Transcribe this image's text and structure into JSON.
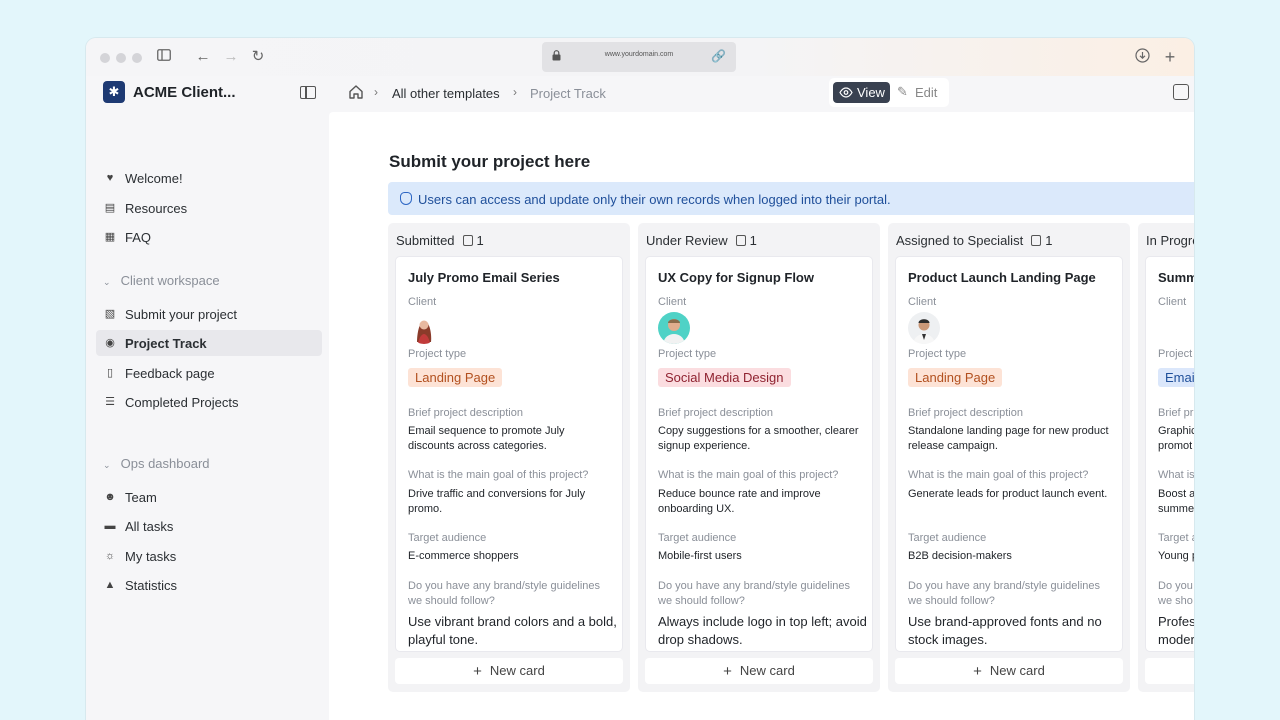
{
  "browser": {
    "url": "www.yourdomain.com"
  },
  "sidebar": {
    "app_title": "ACME Client...",
    "items_top": [
      {
        "label": "Welcome!",
        "icon": "heart-icon"
      },
      {
        "label": "Resources",
        "icon": "document-icon"
      },
      {
        "label": "FAQ",
        "icon": "book-icon"
      }
    ],
    "sections": [
      {
        "title": "Client workspace",
        "items": [
          {
            "label": "Submit your project",
            "icon": "file-icon"
          },
          {
            "label": "Project Track",
            "icon": "eye-icon",
            "active": true
          },
          {
            "label": "Feedback page",
            "icon": "comment-icon"
          },
          {
            "label": "Completed Projects",
            "icon": "database-icon"
          }
        ]
      },
      {
        "title": "Ops dashboard",
        "items": [
          {
            "label": "Team",
            "icon": "users-icon"
          },
          {
            "label": "All tasks",
            "icon": "list-icon"
          },
          {
            "label": "My tasks",
            "icon": "person-scan-icon"
          },
          {
            "label": "Statistics",
            "icon": "chart-icon"
          }
        ]
      }
    ]
  },
  "header": {
    "breadcrumb": [
      "All other templates",
      "Project Track"
    ],
    "view_label": "View",
    "edit_label": "Edit"
  },
  "main": {
    "title": "Submit your project here",
    "notice": "Users can access and update only their own records when logged into their portal.",
    "new_card_label": "New card",
    "field_labels": {
      "client": "Client",
      "project_type": "Project type",
      "brief": "Brief project description",
      "goal": "What is the main goal of this project?",
      "audience": "Target audience",
      "guidelines": "Do you have any brand/style guidelines we should follow?"
    },
    "columns": [
      {
        "title": "Submitted",
        "count": "1",
        "card": {
          "title": "July Promo Email Series",
          "tag": "Landing Page",
          "tag_color": "#fde3d6",
          "tag_text": "#b2501f",
          "brief": "Email sequence to promote July discounts across categories.",
          "goal": "Drive traffic and conversions for July promo.",
          "audience": "E-commerce shoppers",
          "guidelines": "Use vibrant brand colors and a bold, playful tone."
        }
      },
      {
        "title": "Under Review",
        "count": "1",
        "card": {
          "title": "UX Copy for Signup Flow",
          "tag": "Social Media Design",
          "tag_color": "#fbdde0",
          "tag_text": "#8f2230",
          "brief": "Copy suggestions for a smoother, clearer signup experience.",
          "goal": "Reduce bounce rate and improve onboarding UX.",
          "audience": "Mobile-first users",
          "guidelines": "Always include logo in top left; avoid drop shadows."
        }
      },
      {
        "title": "Assigned to Specialist",
        "count": "1",
        "card": {
          "title": "Product Launch Landing Page",
          "tag": "Landing Page",
          "tag_color": "#fde3d6",
          "tag_text": "#b2501f",
          "brief": "Standalone landing page for new product release campaign.",
          "goal": "Generate leads for product launch event.",
          "audience": "B2B decision-makers",
          "guidelines": "Use brand-approved fonts and no stock images."
        }
      },
      {
        "title": "In Progre",
        "count": "",
        "card": {
          "title": "Summ",
          "tag": "Emai",
          "tag_color": "#dbe7fb",
          "tag_text": "#1f4f9a",
          "brief": "Graphic promot",
          "goal": "Boost a summer",
          "audience": "Young p",
          "guidelines": "Profes moder"
        }
      }
    ],
    "partial_labels": {
      "project_type": "Project",
      "brief": "Brief pr",
      "goal": "What is",
      "audience": "Target a",
      "guidelines": "Do you we sho"
    }
  }
}
